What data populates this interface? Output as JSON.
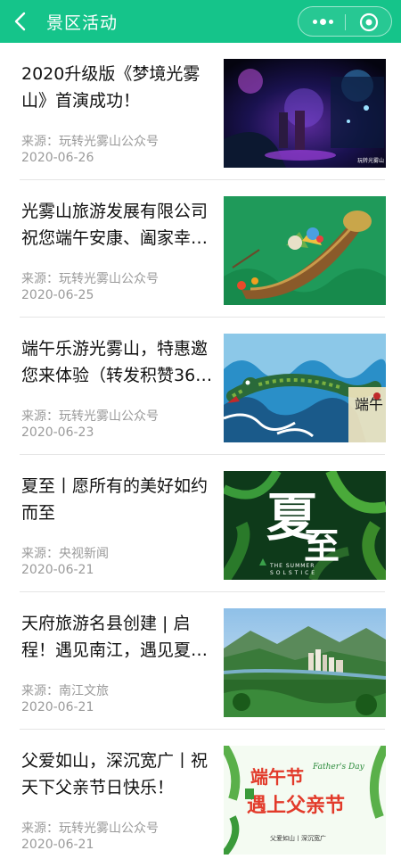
{
  "header": {
    "title": "景区活动",
    "back_icon": "chevron-left-icon",
    "more_icon": "more-dots-icon",
    "close_icon": "target-close-icon",
    "bar_color": "#15c48a"
  },
  "articles": [
    {
      "title": "2020升级版《梦境光雾山》首演成功！",
      "source": "来源：玩转光雾山公众号",
      "date": "2020-06-26",
      "thumb_caption": "玩转光雾山",
      "thumb_icon": "night-show-image"
    },
    {
      "title": "光雾山旅游发展有限公司祝您端午安康、阖家幸…",
      "source": "来源：玩转光雾山公众号",
      "date": "2020-06-25",
      "thumb_icon": "dragon-boat-zongzi-image"
    },
    {
      "title": "端午乐游光雾山，特惠邀您来体验（转发积赞36…",
      "source": "来源：玩转光雾山公众号",
      "date": "2020-06-23",
      "thumb_text": "端午",
      "thumb_icon": "dragon-waves-image"
    },
    {
      "title": "夏至丨愿所有的美好如约而至",
      "source": "来源：央视新闻",
      "date": "2020-06-21",
      "thumb_text_1": "夏",
      "thumb_text_2": "至",
      "thumb_sub": "THE SUMMER",
      "thumb_sub2": "SOLSTICE",
      "thumb_icon": "fern-leaves-image"
    },
    {
      "title": "天府旅游名县创建 | 启程！遇见南江，遇见夏…",
      "source": "来源：南江文旅",
      "date": "2020-06-21",
      "thumb_icon": "mountain-town-image"
    },
    {
      "title": "父爱如山，深沉宽广丨祝天下父亲节日快乐！",
      "source": "来源：玩转光雾山公众号",
      "date": "2020-06-21",
      "thumb_text_1": "端午节",
      "thumb_text_2": "遇上父亲节",
      "thumb_sub": "Father's Day",
      "thumb_sub2": "父爱如山丨深沉宽广",
      "thumb_icon": "fathers-day-image"
    }
  ]
}
